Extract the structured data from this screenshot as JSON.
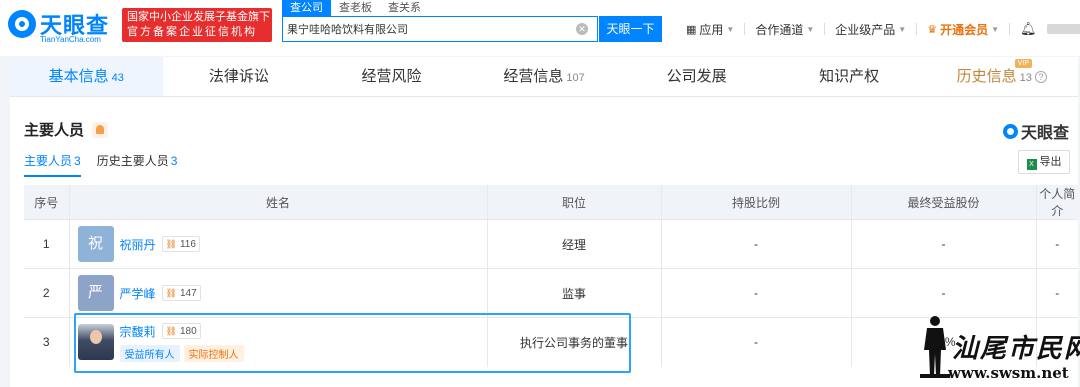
{
  "header": {
    "logo_text": "天眼查",
    "logo_sub": "TianYanCha.com",
    "gov_badge_line1": "国家中小企业发展子基金旗下",
    "gov_badge_line2": "官方备案企业征信机构",
    "search_tabs": [
      "查公司",
      "查老板",
      "查关系"
    ],
    "search_value": "果宁哇哈哈饮料有限公司",
    "search_button": "天眼一下",
    "nav": {
      "apps": "应用",
      "channel": "合作通道",
      "enterprise": "企业级产品",
      "vip": "开通会员"
    }
  },
  "main_tabs": [
    {
      "label": "基本信息",
      "count": "43"
    },
    {
      "label": "法律诉讼",
      "count": ""
    },
    {
      "label": "经营风险",
      "count": ""
    },
    {
      "label": "经营信息",
      "count": "107"
    },
    {
      "label": "公司发展",
      "count": ""
    },
    {
      "label": "知识产权",
      "count": ""
    },
    {
      "label": "历史信息",
      "count": "13",
      "tag": "VIP"
    }
  ],
  "section": {
    "title": "主要人员",
    "brand": "天眼查",
    "sub_tabs": [
      {
        "label": "主要人员",
        "count": "3"
      },
      {
        "label": "历史主要人员",
        "count": "3"
      }
    ],
    "export": "导出"
  },
  "table": {
    "headers": [
      "序号",
      "姓名",
      "职位",
      "持股比例",
      "最终受益股份",
      "个人简介"
    ],
    "rows": [
      {
        "index": "1",
        "avatar_char": "祝",
        "name": "祝丽丹",
        "count": "116",
        "position": "经理",
        "share": "-",
        "benefit": "-",
        "bio": "-",
        "tags": []
      },
      {
        "index": "2",
        "avatar_char": "严",
        "name": "严学峰",
        "count": "147",
        "position": "监事",
        "share": "-",
        "benefit": "-",
        "bio": "-",
        "tags": []
      },
      {
        "index": "3",
        "avatar_char": "",
        "name": "宗馥莉",
        "count": "180",
        "position": "执行公司事务的董事",
        "share": "-",
        "benefit": "60%",
        "bio": "",
        "tags": [
          "受益所有人",
          "实际控制人"
        ]
      }
    ]
  },
  "watermark": {
    "text": "汕尾市民网",
    "url": "www.swsm.net"
  },
  "colors": {
    "accent": "#0084ff",
    "brand_red": "#e62e2e",
    "vip_orange": "#e8720c",
    "highlight_border": "#2aa2ff"
  }
}
